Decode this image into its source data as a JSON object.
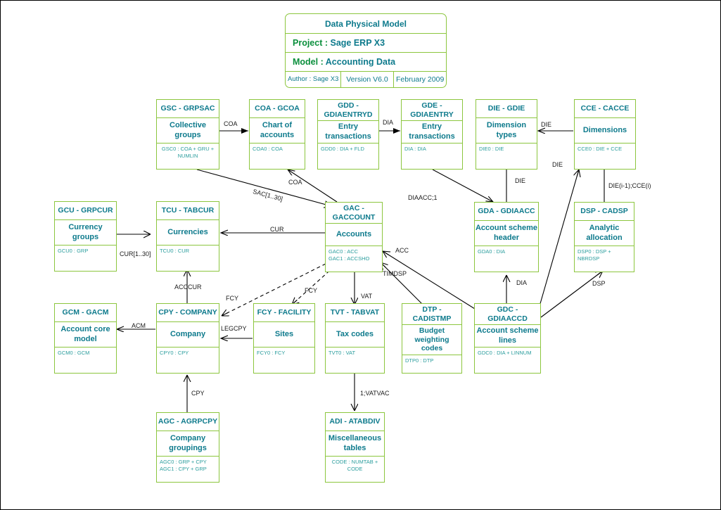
{
  "title_card": {
    "title": "Data Physical Model",
    "project_label": "Project :",
    "project_value": "Sage ERP X3",
    "model_label": "Model   :",
    "model_value": "Accounting Data",
    "author": "Author : Sage  X3",
    "version": "Version V6.0",
    "date": "February 2009"
  },
  "entities": [
    {
      "code": "GSC - GRPSAC",
      "name": "Collective\ngroups",
      "keys": "GSC0 : COA + GRU +\nNUMLIN"
    },
    {
      "code": "COA - GCOA",
      "name": "Chart of\naccounts",
      "keys": "COA0 : COA"
    },
    {
      "code": "GDD -\nGDIAENTRYD",
      "name": "Entry\ntransactions",
      "keys": "GDD0 : DIA + FLD"
    },
    {
      "code": "GDE -\nGDIAENTRY",
      "name": "Entry\ntransactions",
      "keys": "DIA : DIA"
    },
    {
      "code": "DIE - GDIE",
      "name": "Dimension types",
      "keys": "DIE0 : DIE"
    },
    {
      "code": "CCE - CACCE",
      "name": "Dimensions",
      "keys": "CCE0 : DIE + CCE"
    },
    {
      "code": "GCU - GRPCUR",
      "name": "Currency groups",
      "keys": "GCU0 : GRP"
    },
    {
      "code": "TCU - TABCUR",
      "name": "Currencies",
      "keys": "TCU0 : CUR"
    },
    {
      "code": "GAC -\nGACCOUNT",
      "name": "Accounts",
      "keys": "GAC0 : ACC\nGAC1 : ACCSHO"
    },
    {
      "code": "GDA - GDIAACC",
      "name": "Account scheme\nheader",
      "keys": "GDA0 : DIA"
    },
    {
      "code": "DSP - CADSP",
      "name": "Analytic\nallocation",
      "keys": "DSP0 : DSP +\nNBRDSP"
    },
    {
      "code": "GCM - GACM",
      "name": "Account core\nmodel",
      "keys": "GCM0 : GCM"
    },
    {
      "code": "CPY - COMPANY",
      "name": "Company",
      "keys": "CPY0 : CPY"
    },
    {
      "code": "FCY - FACILITY",
      "name": "Sites",
      "keys": "FCY0 : FCY"
    },
    {
      "code": "TVT - TABVAT",
      "name": "Tax codes",
      "keys": "TVT0 : VAT"
    },
    {
      "code": "DTP -\nCADISTMP",
      "name": "Budget\nweighting\ncodes",
      "keys": "DTP0 : DTP"
    },
    {
      "code": "GDC -\nGDIAACCD",
      "name": "Account scheme\nlines",
      "keys": "GDC0 : DIA + LINNUM"
    },
    {
      "code": "AGC - AGRPCPY",
      "name": "Company\ngroupings",
      "keys": "AGC0 : GRP + CPY\nAGC1 : CPY + GRP"
    },
    {
      "code": "ADI - ATABDIV",
      "name": "Miscellaneous\ntables",
      "keys": "CODE : NUMTAB +\nCODE"
    }
  ],
  "edge_labels": [
    {
      "text": "COA"
    },
    {
      "text": "DIA"
    },
    {
      "text": "DIE"
    },
    {
      "text": "DIE"
    },
    {
      "text": "DIE"
    },
    {
      "text": "COA"
    },
    {
      "text": "SAC[1..30]"
    },
    {
      "text": "DIAACC;1"
    },
    {
      "text": "DIE(i-1);CCE(i)"
    },
    {
      "text": "CUR"
    },
    {
      "text": "CUR[1..30]"
    },
    {
      "text": "ACC"
    },
    {
      "text": "TIMDSP"
    },
    {
      "text": "DIA"
    },
    {
      "text": "DSP"
    },
    {
      "text": "ACCCUR"
    },
    {
      "text": "FCY"
    },
    {
      "text": "FCY"
    },
    {
      "text": "ACM"
    },
    {
      "text": "LEGCPY"
    },
    {
      "text": "VAT"
    },
    {
      "text": "CPY"
    },
    {
      "text": "1;VATVAC"
    }
  ],
  "colors": {
    "border": "#8cc63e",
    "text_teal": "#0d7a8c",
    "text_key": "#2a9d9d",
    "text_green": "#0a8f3c",
    "edge": "#000000"
  }
}
